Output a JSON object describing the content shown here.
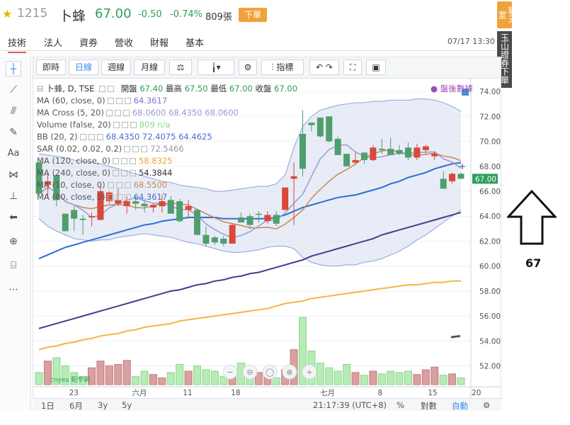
{
  "header": {
    "code": "1215",
    "name": "卜蜂",
    "price": "67.00",
    "change": "-0.50",
    "change_pct": "-0.74%",
    "volume": "809張",
    "order_button": "下單",
    "colors": {
      "down": "#2e9e58",
      "up": "#e25a4a",
      "accent": "#f0a23a"
    }
  },
  "tabs": [
    {
      "label": "技術",
      "active": true
    },
    {
      "label": "法人"
    },
    {
      "label": "資券"
    },
    {
      "label": "營收"
    },
    {
      "label": "財報"
    },
    {
      "label": "基本"
    }
  ],
  "datetime": "07/17 13:30",
  "side_buttons": {
    "chat": "聊天室",
    "broker": "玉山證券下單"
  },
  "toolbar": {
    "intraday": "即時",
    "daily": "日線",
    "weekly": "週線",
    "monthly": "月線",
    "indicators": "指標",
    "icons": [
      "balance-icon",
      "candle-icon",
      "gear-icon",
      "indicator-icon",
      "undo-icon",
      "redo-icon",
      "fullscreen-icon",
      "camera-icon"
    ]
  },
  "chart_header": {
    "symbol": "卜蜂, D, TSE",
    "open_label": "開盤",
    "open": "67.40",
    "high_label": "最高",
    "high": "67.50",
    "low_label": "最低",
    "low": "67.00",
    "close_label": "收盤",
    "close": "67.00",
    "after_hours": "盤後數據"
  },
  "indicators": [
    {
      "name": "MA (60, close, 0)",
      "value": "64.3617",
      "color": "#7b7bc8"
    },
    {
      "name": "MA Cross (5, 20)",
      "value": "68.0600 68.4350 68.0600",
      "color": "#9a9ad6"
    },
    {
      "name": "Volume (false, 20)",
      "value": "809 n/a",
      "color": "#8bdc8b"
    },
    {
      "name": "BB (20, 2)",
      "value": "68.4350 72.4075 64.4625",
      "color": "#4a6ec8"
    },
    {
      "name": "SAR (0.02, 0.02, 0.2)",
      "value": "72.5466",
      "color": "#999999"
    },
    {
      "name": "MA (120, close, 0)",
      "value": "58.8325",
      "color": "#f0a23a"
    },
    {
      "name": "MA (240, close, 0)",
      "value": "54.3844",
      "color": "#333333"
    },
    {
      "name": "MA (10, close, 0)",
      "value": "68.5500",
      "color": "#c9884e"
    },
    {
      "name": "MA (60, close, 0)",
      "value": "64.3617",
      "color": "#4a6ec8"
    }
  ],
  "y_ticks": [
    "74.00",
    "72.00",
    "70.00",
    "68.00",
    "66.00",
    "64.00",
    "62.00",
    "60.00",
    "58.00",
    "56.00",
    "54.00",
    "52.00"
  ],
  "x_ticks": [
    "23",
    "六月",
    "11",
    "18",
    "七月",
    "8",
    "15",
    "20"
  ],
  "price_tag": "67.00",
  "watermark": "cnyes 鉅亨網",
  "bottom_bar": {
    "ranges": [
      "1日",
      "6月",
      "3y",
      "5y"
    ],
    "time": "21:17:39 (UTC+8)",
    "pct": "%",
    "log": "對數",
    "auto": "自動"
  },
  "annotation_value": "67",
  "chart_data": {
    "type": "candlestick",
    "ylim": [
      50.5,
      74.8
    ],
    "candles_ohlc": [
      [
        68.3,
        68.3,
        65.8,
        65.8
      ],
      [
        66.5,
        67.5,
        65.5,
        66.8
      ],
      [
        67.3,
        67.3,
        64.8,
        65.3
      ],
      [
        64.2,
        64.2,
        62.8,
        62.8
      ],
      [
        64.5,
        64.8,
        62.8,
        63.8
      ],
      [
        63.8,
        64.1,
        62.5,
        63.7
      ],
      [
        63.9,
        64.3,
        63.2,
        64.0
      ],
      [
        63.7,
        66.5,
        63.7,
        66.0
      ],
      [
        65.2,
        66.0,
        65.0,
        65.9
      ],
      [
        65.0,
        66.2,
        64.8,
        65.3
      ],
      [
        64.8,
        65.6,
        64.2,
        65.2
      ],
      [
        65.2,
        65.6,
        64.5,
        65.0
      ],
      [
        65.0,
        65.3,
        64.3,
        64.8
      ],
      [
        64.7,
        65.0,
        64.3,
        64.9
      ],
      [
        64.8,
        65.7,
        64.3,
        65.2
      ],
      [
        65.3,
        65.6,
        64.2,
        64.2
      ],
      [
        65.2,
        65.4,
        63.5,
        63.6
      ],
      [
        64.5,
        65.3,
        63.8,
        64.8
      ],
      [
        64.5,
        64.6,
        62.5,
        62.5
      ],
      [
        62.5,
        63.2,
        61.6,
        61.8
      ],
      [
        62.3,
        62.4,
        61.7,
        61.9
      ],
      [
        62.2,
        62.4,
        61.6,
        61.8
      ],
      [
        61.8,
        63.4,
        61.8,
        63.3
      ],
      [
        63.9,
        64.3,
        63.5,
        63.5
      ],
      [
        64.0,
        64.2,
        63.0,
        63.3
      ],
      [
        64.2,
        64.4,
        63.5,
        64.2
      ],
      [
        63.6,
        64.4,
        63.4,
        64.1
      ],
      [
        64.1,
        64.4,
        63.2,
        63.4
      ],
      [
        64.5,
        66.3,
        64.5,
        66.3
      ],
      [
        67.0,
        68.3,
        63.3,
        67.2
      ],
      [
        70.6,
        72.5,
        67.2,
        67.8
      ],
      [
        71.5,
        71.5,
        70.8,
        71.3
      ],
      [
        71.9,
        71.9,
        70.3,
        70.4
      ],
      [
        72.0,
        72.0,
        69.9,
        70.0
      ],
      [
        70.2,
        70.4,
        68.9,
        68.9
      ],
      [
        69.0,
        69.0,
        68.0,
        68.0
      ],
      [
        68.3,
        69.1,
        68.2,
        68.5
      ],
      [
        69.1,
        69.1,
        68.2,
        68.5
      ],
      [
        68.5,
        69.7,
        68.4,
        69.5
      ],
      [
        69.4,
        70.2,
        69.0,
        69.3
      ],
      [
        69.4,
        70.3,
        68.9,
        68.9
      ],
      [
        69.3,
        69.7,
        68.9,
        69.0
      ],
      [
        69.5,
        69.9,
        68.5,
        68.7
      ],
      [
        68.7,
        69.8,
        68.5,
        69.5
      ],
      [
        69.3,
        69.7,
        69.0,
        69.6
      ],
      [
        68.8,
        69.2,
        68.5,
        69.0
      ],
      [
        67.0,
        67.6,
        66.2,
        66.2
      ],
      [
        66.8,
        67.5,
        66.6,
        67.4
      ],
      [
        67.4,
        67.5,
        67.0,
        67.0
      ]
    ],
    "volume_relative": [
      0.18,
      0.35,
      0.4,
      0.28,
      0.18,
      0.12,
      0.25,
      0.35,
      0.28,
      0.3,
      0.36,
      0.12,
      0.2,
      0.15,
      0.1,
      0.18,
      0.3,
      0.2,
      0.28,
      0.22,
      0.2,
      0.12,
      0.2,
      0.32,
      0.15,
      0.18,
      0.12,
      0.1,
      0.22,
      0.52,
      1.0,
      0.5,
      0.32,
      0.25,
      0.2,
      0.3,
      0.18,
      0.14,
      0.2,
      0.16,
      0.2,
      0.18,
      0.2,
      0.15,
      0.22,
      0.26,
      0.14,
      0.16,
      0.1
    ],
    "ma_series": {
      "bb_upper": [
        69.0,
        68.9,
        68.8,
        68.7,
        68.5,
        68.4,
        68.3,
        68.2,
        68.0,
        67.8,
        67.6,
        67.4,
        67.2,
        67.0,
        66.8,
        66.7,
        66.5,
        66.4,
        66.3,
        66.2,
        66.0,
        66.0,
        66.1,
        66.2,
        66.3,
        66.4,
        66.4,
        66.6,
        67.3,
        69.5,
        71.2,
        72.0,
        72.5,
        72.7,
        72.9,
        73.0,
        73.1,
        73.1,
        73.2,
        73.2,
        73.3,
        73.3,
        73.3,
        73.4,
        73.4,
        73.3,
        73.1,
        72.8,
        72.4
      ],
      "bb_lower": [
        63.8,
        63.2,
        62.8,
        62.5,
        62.2,
        62.1,
        62.0,
        62.1,
        62.1,
        62.3,
        62.4,
        62.5,
        62.6,
        62.5,
        62.4,
        62.3,
        62.1,
        61.9,
        61.8,
        61.6,
        61.4,
        61.2,
        61.1,
        61.1,
        61.2,
        61.3,
        61.5,
        61.6,
        61.6,
        61.4,
        60.7,
        60.3,
        60.1,
        60.0,
        60.0,
        60.1,
        60.1,
        60.3,
        60.4,
        60.6,
        60.9,
        61.2,
        61.6,
        62.1,
        62.5,
        63.0,
        63.5,
        64.0,
        64.5
      ],
      "ma_blue": [
        60.6,
        60.9,
        61.2,
        61.5,
        61.7,
        61.9,
        62.1,
        62.3,
        62.5,
        62.7,
        62.9,
        63.1,
        63.3,
        63.4,
        63.6,
        63.7,
        63.8,
        63.9,
        63.9,
        63.9,
        63.9,
        63.8,
        63.8,
        63.8,
        63.8,
        63.8,
        63.8,
        63.9,
        64.1,
        64.4,
        64.7,
        64.9,
        65.1,
        65.3,
        65.5,
        65.6,
        65.7,
        65.9,
        66.1,
        66.3,
        66.6,
        66.8,
        67.1,
        67.3,
        67.5,
        67.8,
        68.0,
        68.2,
        68.3
      ],
      "ma_purple": [
        55.0,
        55.2,
        55.4,
        55.6,
        55.8,
        56.0,
        56.2,
        56.4,
        56.6,
        56.8,
        57.0,
        57.2,
        57.4,
        57.6,
        57.8,
        58.0,
        58.1,
        58.3,
        58.5,
        58.6,
        58.8,
        58.9,
        59.1,
        59.2,
        59.4,
        59.5,
        59.7,
        59.9,
        60.1,
        60.3,
        60.5,
        60.8,
        61.0,
        61.2,
        61.4,
        61.6,
        61.8,
        62.0,
        62.2,
        62.5,
        62.7,
        62.9,
        63.1,
        63.3,
        63.5,
        63.7,
        63.9,
        64.1,
        64.3
      ],
      "ma_orange": [
        53.3,
        53.5,
        53.6,
        53.8,
        53.9,
        54.1,
        54.2,
        54.4,
        54.5,
        54.6,
        54.8,
        54.9,
        55.1,
        55.2,
        55.3,
        55.4,
        55.6,
        55.7,
        55.8,
        55.9,
        56.0,
        56.1,
        56.2,
        56.3,
        56.4,
        56.5,
        56.6,
        56.8,
        57.0,
        57.1,
        57.2,
        57.4,
        57.5,
        57.6,
        57.7,
        57.8,
        57.9,
        58.0,
        58.1,
        58.2,
        58.3,
        58.4,
        58.5,
        58.5,
        58.6,
        58.7,
        58.7,
        58.8,
        58.8
      ]
    }
  }
}
